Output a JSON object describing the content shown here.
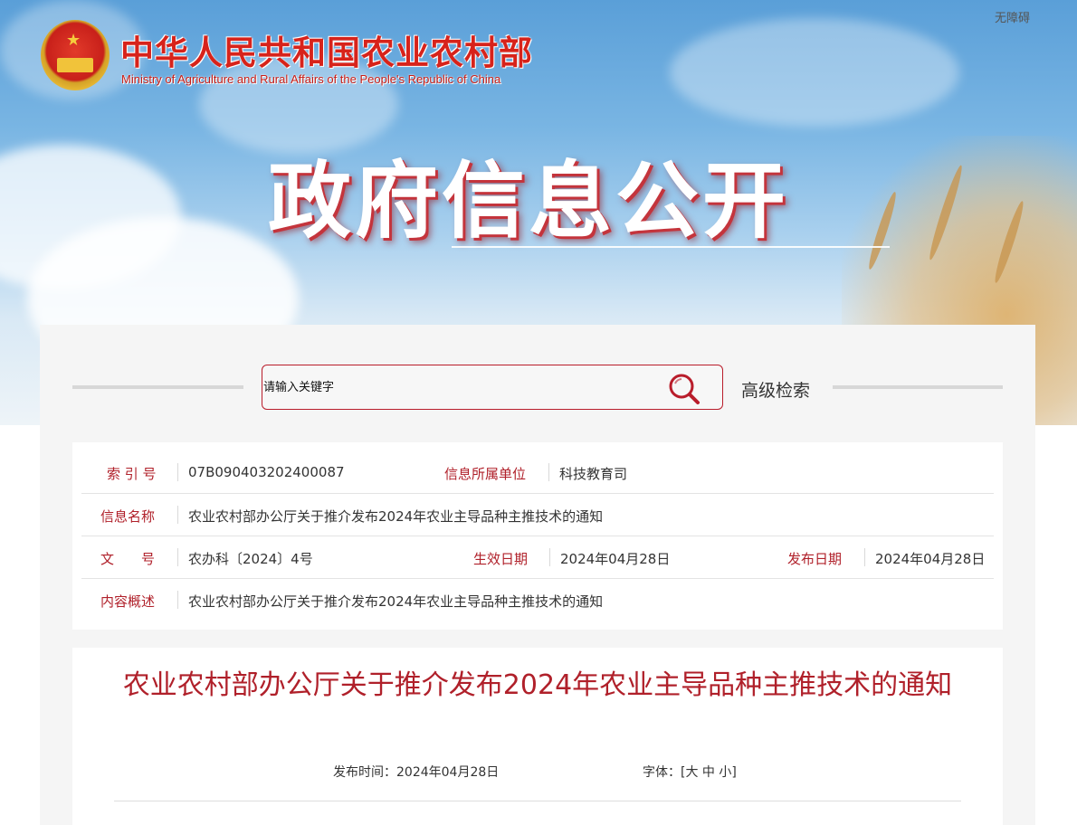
{
  "header": {
    "accessibility_label": "无障碍",
    "ministry_name_cn": "中华人民共和国农业农村部",
    "ministry_name_en": "Ministry of Agriculture and Rural Affairs of the People's Republic of China",
    "hero_title": "政府信息公开"
  },
  "search": {
    "placeholder": "请输入关键字",
    "value": "",
    "advanced_label": "高级检索"
  },
  "meta": {
    "index_label": "索 引 号",
    "index_value": "07B090403202400087",
    "org_label": "信息所属单位",
    "org_value": "科技教育司",
    "name_label": "信息名称",
    "name_value": "农业农村部办公厅关于推介发布2024年农业主导品种主推技术的通知",
    "doc_no_label": "文　　号",
    "doc_no_value": "农办科〔2024〕4号",
    "effective_label": "生效日期",
    "effective_value": "2024年04月28日",
    "publish_label": "发布日期",
    "publish_value": "2024年04月28日",
    "summary_label": "内容概述",
    "summary_value": "农业农村部办公厅关于推介发布2024年农业主导品种主推技术的通知"
  },
  "article": {
    "title": "农业农村部办公厅关于推介发布2024年农业主导品种主推技术的通知",
    "publish_time_label": "发布时间：",
    "publish_time_value": "2024年04月28日",
    "font_label": "字体：",
    "font_open": "[",
    "font_large": "大",
    "font_medium": "中",
    "font_small": "小",
    "font_close": "]"
  },
  "colors": {
    "brand_red": "#b0202a",
    "panel_bg": "#f5f5f5"
  }
}
